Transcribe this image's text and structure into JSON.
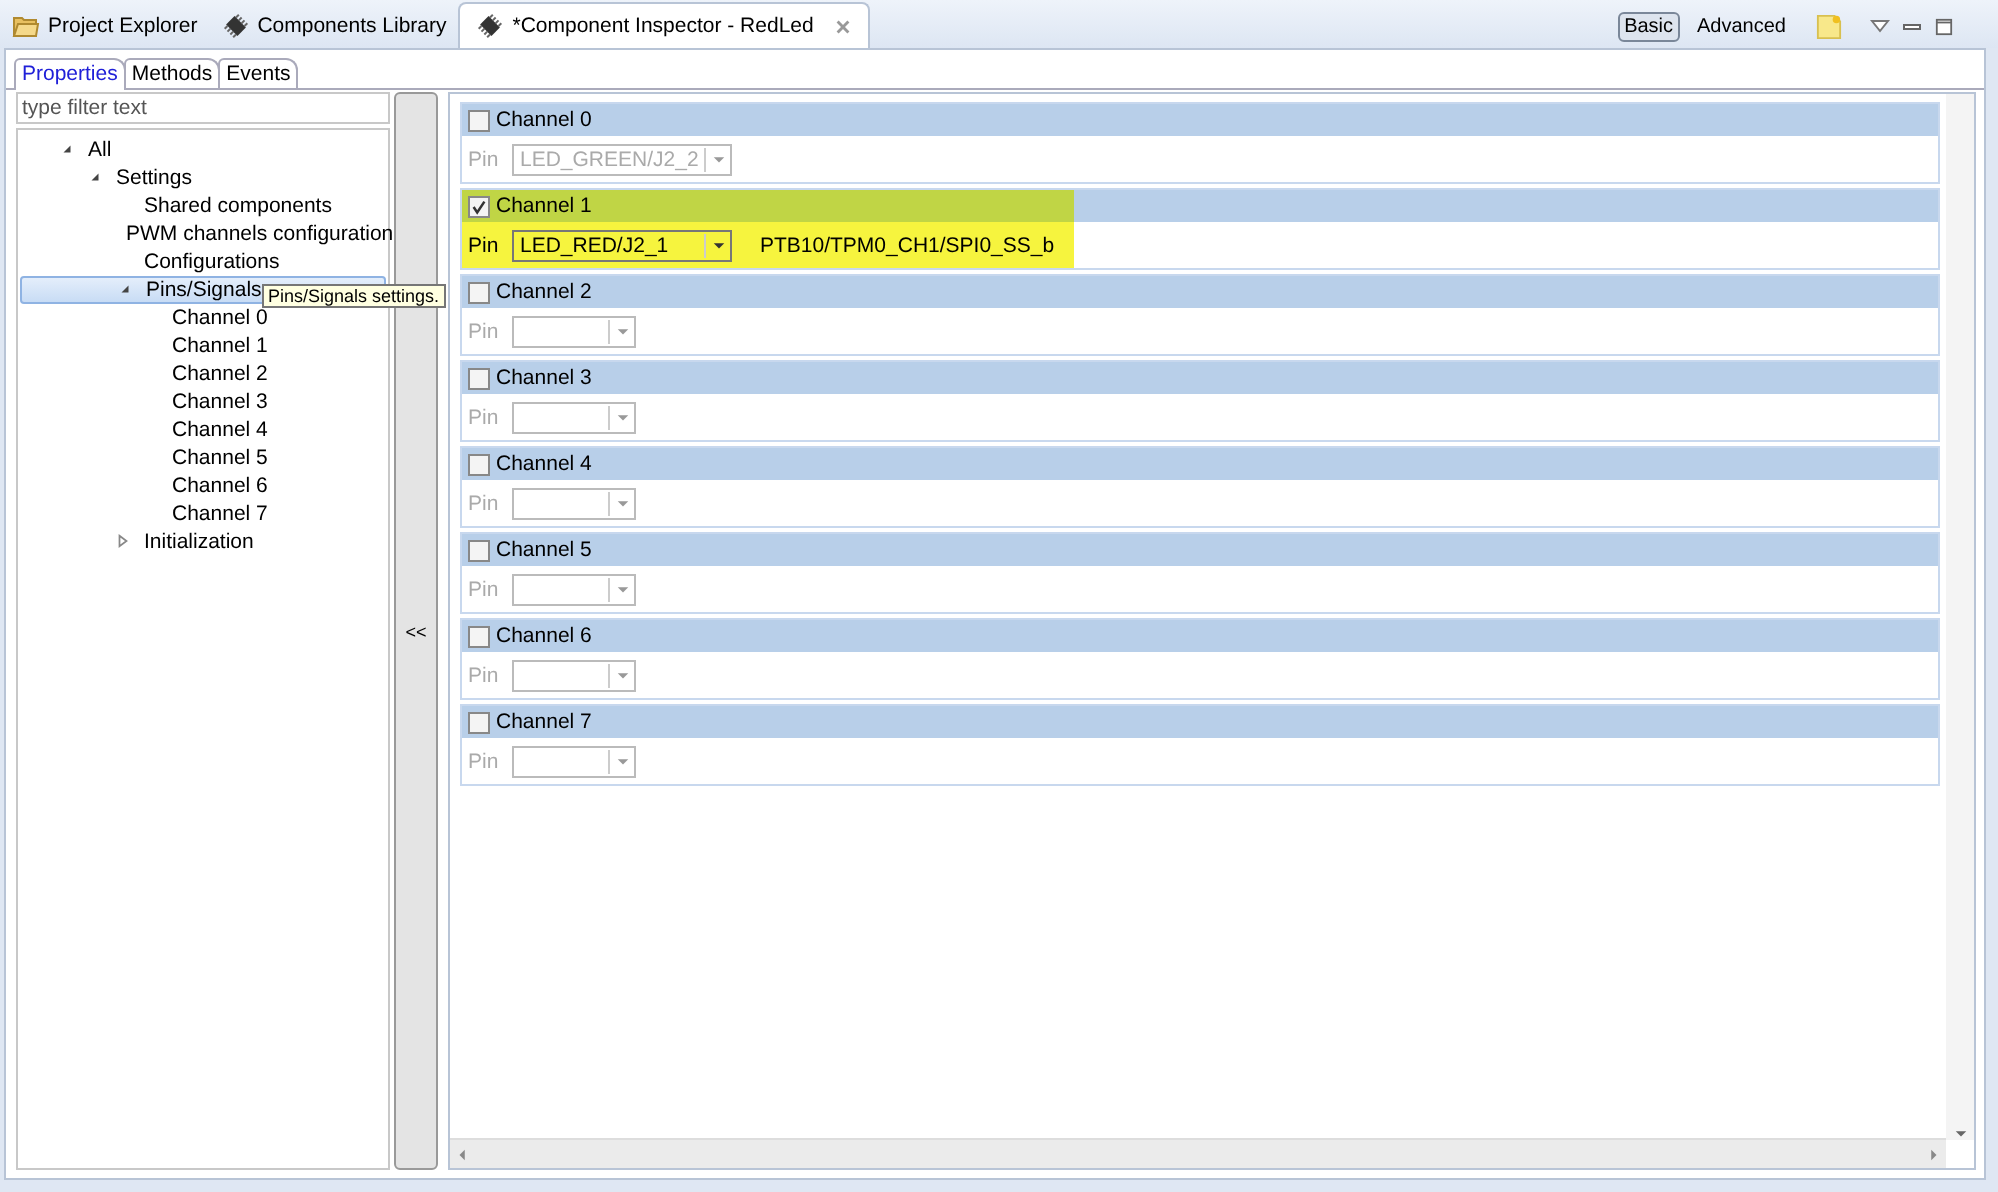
{
  "view_tabs": [
    {
      "label": "Project Explorer",
      "selected": false
    },
    {
      "label": "Components Library",
      "selected": false
    },
    {
      "label": "*Component Inspector - RedLed",
      "selected": true
    }
  ],
  "mode_buttons": [
    {
      "label": "Basic",
      "selected": true
    },
    {
      "label": "Advanced",
      "selected": false
    }
  ],
  "inspector_tabs": [
    {
      "label": "Properties",
      "selected": true
    },
    {
      "label": "Methods",
      "selected": false
    },
    {
      "label": "Events",
      "selected": false
    }
  ],
  "filter": {
    "placeholder": "type filter text"
  },
  "tree": [
    {
      "label": "All",
      "expanded": true,
      "selected": false,
      "children": [
        {
          "label": "Settings",
          "expanded": true,
          "selected": false,
          "children": [
            {
              "label": "Shared components",
              "selected": false
            },
            {
              "label": "PWM channels configuration",
              "selected": false
            },
            {
              "label": "Configurations",
              "selected": false
            },
            {
              "label": "Pins/Signals",
              "expanded": true,
              "selected": true,
              "children": [
                {
                  "label": "Channel 0",
                  "selected": false
                },
                {
                  "label": "Channel 1",
                  "selected": false
                },
                {
                  "label": "Channel 2",
                  "selected": false
                },
                {
                  "label": "Channel 3",
                  "selected": false
                },
                {
                  "label": "Channel 4",
                  "selected": false
                },
                {
                  "label": "Channel 5",
                  "selected": false
                },
                {
                  "label": "Channel 6",
                  "selected": false
                },
                {
                  "label": "Channel 7",
                  "selected": false
                }
              ]
            },
            {
              "label": "Initialization",
              "expanded": false,
              "selected": false
            }
          ]
        }
      ]
    }
  ],
  "tooltip": "Pins/Signals settings.",
  "collapse_button": "<<",
  "channels": [
    {
      "title": "Channel 0",
      "checked": false,
      "highlighted": false,
      "pin_label": "Pin",
      "pin": "LED_GREEN/J2_2"
    },
    {
      "title": "Channel 1",
      "checked": true,
      "highlighted": true,
      "pin_label": "Pin",
      "pin": "LED_RED/J2_1",
      "signal": "PTB10/TPM0_CH1/SPI0_SS_b"
    },
    {
      "title": "Channel 2",
      "checked": false,
      "highlighted": false,
      "pin_label": "Pin"
    },
    {
      "title": "Channel 3",
      "checked": false,
      "highlighted": false,
      "pin_label": "Pin"
    },
    {
      "title": "Channel 4",
      "checked": false,
      "highlighted": false,
      "pin_label": "Pin"
    },
    {
      "title": "Channel 5",
      "checked": false,
      "highlighted": false,
      "pin_label": "Pin"
    },
    {
      "title": "Channel 6",
      "checked": false,
      "highlighted": false,
      "pin_label": "Pin"
    },
    {
      "title": "Channel 7",
      "checked": false,
      "highlighted": false,
      "pin_label": "Pin"
    }
  ]
}
